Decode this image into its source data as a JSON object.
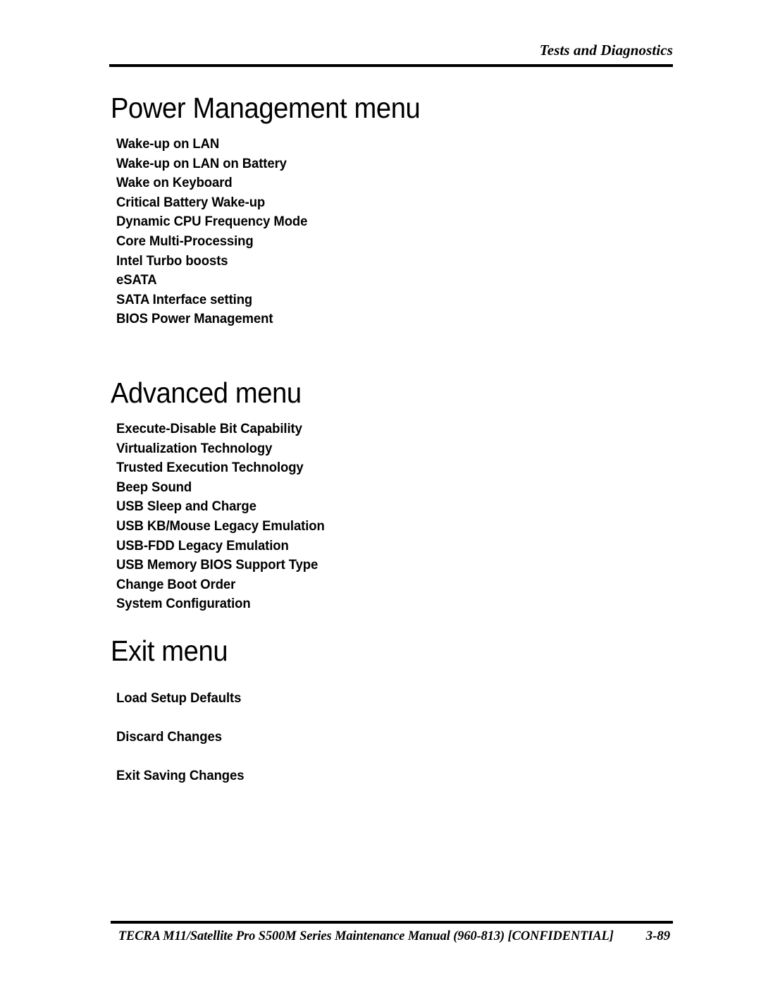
{
  "header": {
    "title": "Tests and Diagnostics"
  },
  "sections": [
    {
      "id": "power",
      "heading": "Power Management menu",
      "items": [
        "Wake-up on LAN",
        "Wake-up on LAN on Battery",
        "Wake on Keyboard",
        "Critical Battery Wake-up",
        "Dynamic CPU Frequency Mode",
        "Core Multi-Processing",
        "Intel Turbo boosts",
        "eSATA",
        "SATA Interface setting",
        "BIOS Power Management"
      ]
    },
    {
      "id": "advanced",
      "heading": "Advanced menu",
      "items": [
        "Execute-Disable Bit Capability",
        "Virtualization Technology",
        "Trusted Execution Technology",
        "Beep Sound",
        "USB Sleep and Charge",
        "USB KB/Mouse Legacy Emulation",
        "USB-FDD Legacy Emulation",
        "USB Memory BIOS Support Type",
        "Change Boot Order",
        "System Configuration"
      ]
    },
    {
      "id": "exit",
      "heading": "Exit menu",
      "items": [
        "Load Setup Defaults",
        "Discard Changes",
        "Exit Saving Changes"
      ]
    }
  ],
  "footer": {
    "text": "TECRA M11/Satellite Pro S500M Series Maintenance Manual (960-813) [CONFIDENTIAL]",
    "page_number": "3-89"
  },
  "colors": {
    "page_background": "#ffffff",
    "text": "#000000",
    "rule": "#000000"
  }
}
